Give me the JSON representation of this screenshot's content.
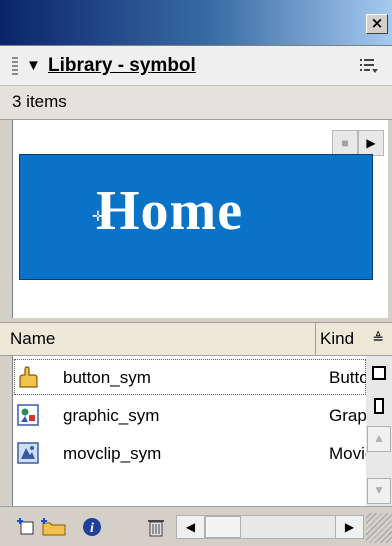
{
  "window": {
    "close_label": "×"
  },
  "panel": {
    "title": "Library - symbol",
    "collapse_glyph": "▼",
    "options_icon": "panel-options-icon"
  },
  "library": {
    "item_count": "3 items"
  },
  "preview": {
    "label": "Home",
    "background_color": "#0b73c7",
    "stop_glyph": "■",
    "play_glyph": "▶"
  },
  "columns": {
    "name": "Name",
    "kind": "Kind",
    "sort_glyph": "≜"
  },
  "items": [
    {
      "name": "button_sym",
      "kind": "Button",
      "icon": "button-symbol-icon"
    },
    {
      "name": "graphic_sym",
      "kind": "Graphic",
      "icon": "graphic-symbol-icon"
    },
    {
      "name": "movclip_sym",
      "kind": "Movie Clip",
      "icon": "movieclip-symbol-icon"
    }
  ],
  "toolbar": {
    "icons": [
      "new-symbol-icon",
      "new-folder-icon",
      "properties-icon",
      "delete-icon"
    ],
    "scroll_left_glyph": "◀",
    "scroll_right_glyph": "▶"
  }
}
